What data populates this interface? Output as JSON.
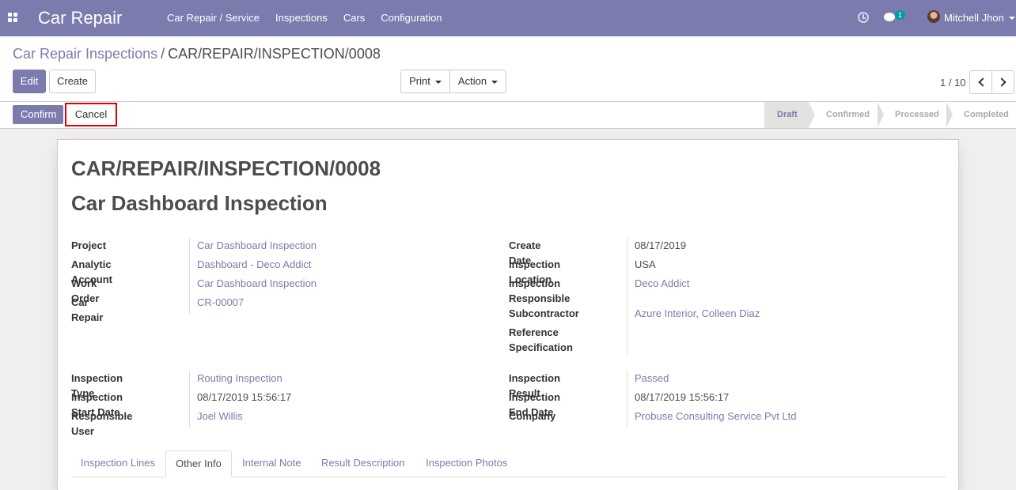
{
  "navbar": {
    "brand": "Car Repair",
    "menu": [
      "Car Repair / Service",
      "Inspections",
      "Cars",
      "Configuration"
    ],
    "chat_count": "1",
    "user_name": "Mitchell Jhon",
    "accent_color": "#7c7bad"
  },
  "breadcrumb": {
    "parent": "Car Repair Inspections",
    "separator": "/",
    "current": "CAR/REPAIR/INSPECTION/0008"
  },
  "toolbar": {
    "edit_label": "Edit",
    "create_label": "Create",
    "print_label": "Print",
    "action_label": "Action"
  },
  "pager": {
    "value": "1 / 10"
  },
  "statusbar": {
    "confirm_label": "Confirm",
    "cancel_label": "Cancel",
    "stages": [
      "Draft",
      "Confirmed",
      "Processed",
      "Completed"
    ],
    "active_stage": "Draft"
  },
  "record": {
    "reference": "CAR/REPAIR/INSPECTION/0008",
    "name": "Car Dashboard Inspection",
    "left_group1": [
      {
        "label": "Project",
        "value": "Car Dashboard Inspection",
        "link": true
      },
      {
        "label": "Analytic Account",
        "value": "Dashboard - Deco Addict",
        "link": true
      },
      {
        "label": "Work Order",
        "value": "Car Dashboard Inspection",
        "link": true
      },
      {
        "label": "Car Repair",
        "value": "CR-00007",
        "link": true
      }
    ],
    "right_group1": [
      {
        "label": "Create Date",
        "value": "08/17/2019",
        "link": false
      },
      {
        "label": "Inspection Location",
        "value": "USA",
        "link": false
      },
      {
        "label": "Inspection Responsible",
        "value": "Deco Addict",
        "link": true
      },
      {
        "label": "Subcontractor",
        "value": "Azure Interior, Colleen Diaz",
        "link": true
      },
      {
        "label": "Reference Specification",
        "value": "",
        "link": false
      }
    ],
    "left_group2": [
      {
        "label": "Inspection Type",
        "value": "Routing Inspection",
        "link": true
      },
      {
        "label": "Inspection Start Date",
        "value": "08/17/2019 15:56:17",
        "link": false
      },
      {
        "label": "Responsible User",
        "value": "Joel Willis",
        "link": true
      }
    ],
    "right_group2": [
      {
        "label": "Inspection Result",
        "value": "Passed",
        "link": true
      },
      {
        "label": "Inspection End Date",
        "value": "08/17/2019 15:56:17",
        "link": false
      },
      {
        "label": "Company",
        "value": "Probuse Consulting Service Pvt Ltd",
        "link": true
      }
    ]
  },
  "tabs": [
    "Inspection Lines",
    "Other Info",
    "Internal Note",
    "Result Description",
    "Inspection Photos"
  ],
  "active_tab": "Other Info"
}
